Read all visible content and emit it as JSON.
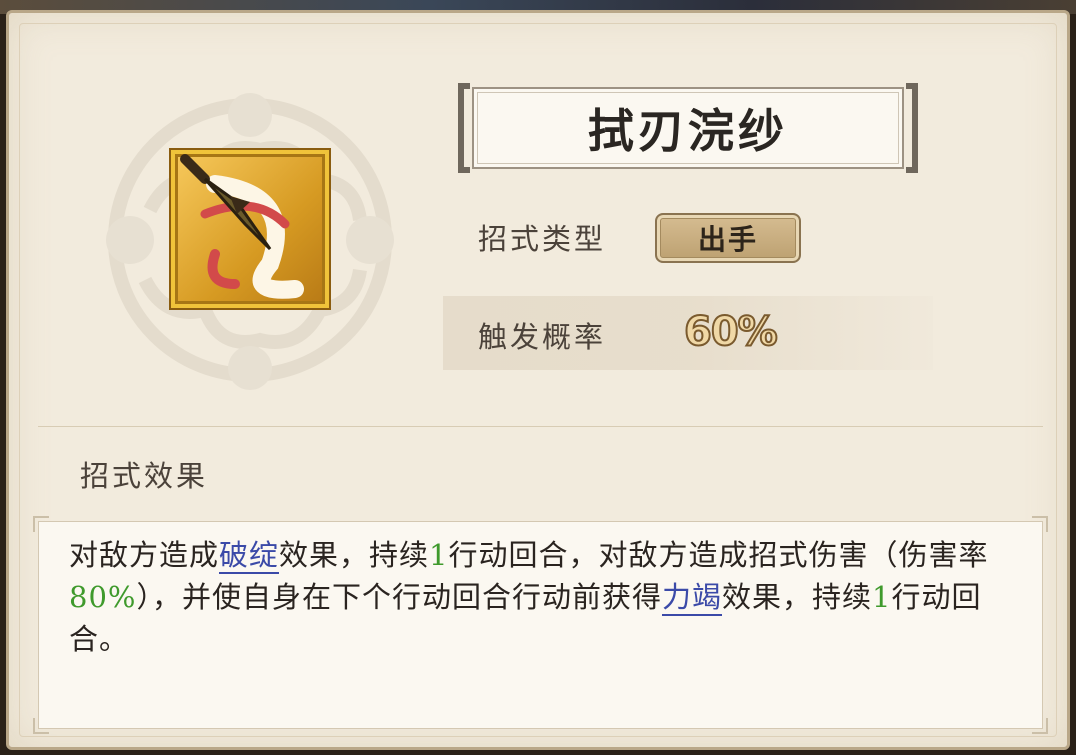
{
  "skill": {
    "name": "拭刃浣纱",
    "type_label": "招式类型",
    "type_value": "出手",
    "rate_label": "触发概率",
    "rate_value": "60%",
    "icon": "dagger-with-red-ribbon-icon"
  },
  "effects": {
    "label": "招式效果",
    "segments": {
      "s1": "对敌方造成",
      "k1": "破绽",
      "s2": "效果，持续",
      "n1": "1",
      "s3": "行动回合，对敌方造成招式伤害（伤害率",
      "n2": "80%",
      "s4": "），并使自身在下个行动回合行动前获得",
      "k2": "力竭",
      "s5": "效果，持续",
      "n3": "1",
      "s6": "行动回合。"
    }
  },
  "colors": {
    "keyword": "#3b4aa8",
    "number": "#3f9a2c",
    "panel": "#f2ebdd"
  }
}
